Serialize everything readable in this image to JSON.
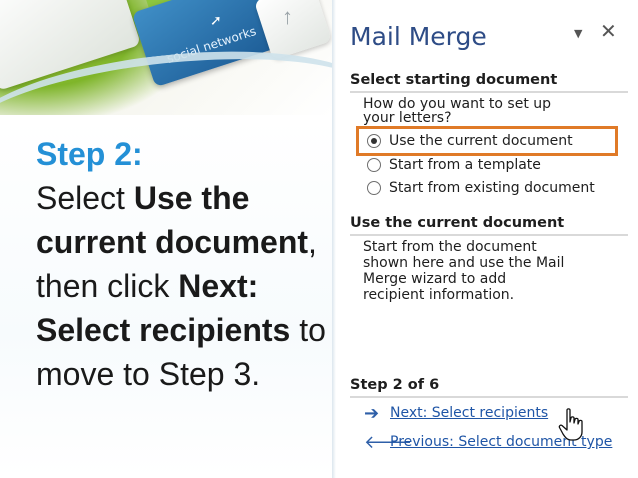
{
  "slide": {
    "photo_caption": "social networks",
    "step_heading": "Step 2:",
    "step_parts": [
      "Select ",
      "Use the current document",
      ", then click ",
      "Next: Select recipients",
      " to move to Step 3."
    ]
  },
  "pane": {
    "title": "Mail Merge",
    "dropdown_icon": "▼",
    "close_icon": "✕",
    "section1_heading": "Select starting document",
    "question_line1": "How do you want to set up",
    "question_line2": "your letters?",
    "options": [
      {
        "label": "Use the current document",
        "selected": true
      },
      {
        "label": "Start from a template",
        "selected": false
      },
      {
        "label": "Start from existing document",
        "selected": false
      }
    ],
    "section2_heading": "Use the current document",
    "description_lines": [
      "Start from the document",
      "shown here and use the Mail",
      "Merge wizard to add",
      "recipient information."
    ],
    "step_label": "Step 2 of 6",
    "next_link": "Next: Select recipients",
    "previous_link": "Previous: Select document type"
  },
  "colors": {
    "accent_blue": "#2490d6",
    "pane_title": "#2e4c86",
    "link": "#1f55a6",
    "highlight_border": "#e07a27"
  },
  "icons": {
    "next_arrow": "arrow-right-icon",
    "previous_arrow": "arrow-left-icon",
    "cursor": "hand-pointer-icon"
  }
}
